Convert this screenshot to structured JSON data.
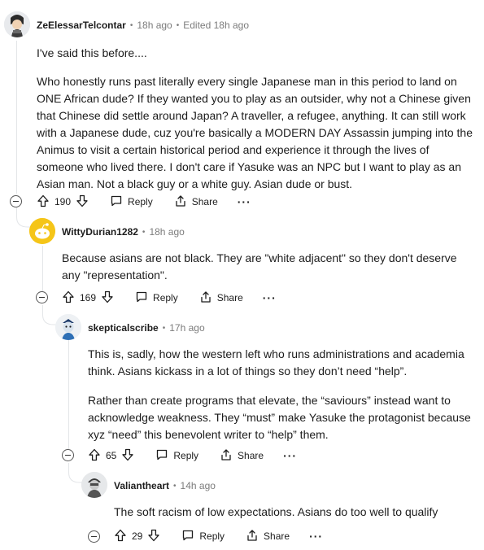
{
  "comments": [
    {
      "author": "ZeElessarTelcontar",
      "time": "18h ago",
      "edited": "Edited 18h ago",
      "paragraphs": [
        "I've said this before....",
        "Who honestly runs past literally every single Japanese man in this period to land on ONE African dude? If they wanted you to play as an outsider, why not a Chinese given that Chinese did settle around Japan? A traveller, a refugee, anything. It can still work with a Japanese dude, cuz you're basically a MODERN DAY Assassin jumping into the Animus to visit a certain historical period and experience it through the lives of someone who lived there. I don't care if Yasuke was an NPC but I want to play as an Asian man. Not a black guy or a white guy. Asian dude or bust."
      ],
      "votes": "190"
    },
    {
      "author": "WittyDurian1282",
      "time": "18h ago",
      "paragraphs": [
        "Because asians are not black. They are \"white adjacent\" so they don't deserve any \"representation\"."
      ],
      "votes": "169"
    },
    {
      "author": "skepticalscribe",
      "time": "17h ago",
      "paragraphs": [
        "This is, sadly, how the western left who runs administrations and academia think. Asians kickass in a lot of things so they don’t need “help”.",
        "Rather than create programs that elevate, the “saviours” instead want to acknowledge weakness. They “must” make Yasuke the protagonist because xyz “need” this benevolent writer to “help” them."
      ],
      "votes": "65"
    },
    {
      "author": "Valiantheart",
      "time": "14h ago",
      "paragraphs": [
        "The soft racism of low expectations. Asians do too well to qualify"
      ],
      "votes": "29"
    }
  ],
  "actions": {
    "reply_label": "Reply",
    "share_label": "Share",
    "more_label": "···"
  },
  "icons": {
    "upvote": "upvote-icon",
    "downvote": "downvote-icon",
    "reply": "reply-icon",
    "share": "share-icon",
    "more": "more-icon",
    "collapse": "collapse-icon"
  },
  "colors": {
    "text": "#1c1c1c",
    "meta": "#7c7c7c",
    "thread_line": "#e3e5e8",
    "avatar_yellow": "#f5c518"
  }
}
